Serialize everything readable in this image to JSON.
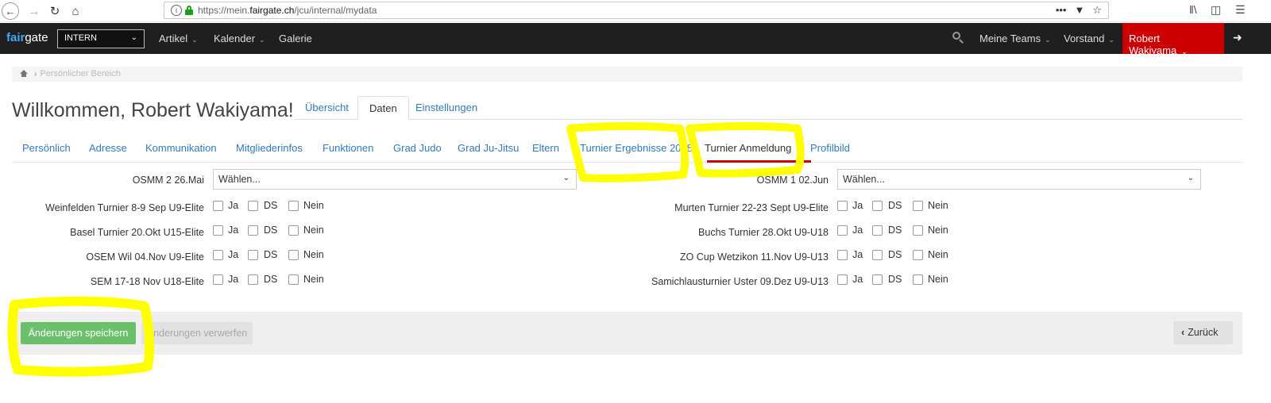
{
  "browser": {
    "url_prefix": "https://mein.",
    "url_domain": "fairgate.ch",
    "url_path": "/jcu/internal/mydata",
    "more_icon": "•••"
  },
  "nav": {
    "logo_a": "fair",
    "logo_b": "gate",
    "org_select": "INTERN",
    "items": [
      "Artikel",
      "Kalender",
      "Galerie"
    ],
    "right_items": [
      "Meine Teams",
      "Vorstand"
    ],
    "user": "Robert Wakiyama"
  },
  "breadcrumb": {
    "label": "Persönlicher Bereich"
  },
  "page": {
    "title": "Willkommen, Robert Wakiyama!"
  },
  "main_tabs": [
    {
      "label": "Übersicht",
      "active": false
    },
    {
      "label": "Daten",
      "active": true
    },
    {
      "label": "Einstellungen",
      "active": false
    }
  ],
  "sub_tabs": [
    {
      "label": "Persönlich"
    },
    {
      "label": "Adresse"
    },
    {
      "label": "Kommunikation"
    },
    {
      "label": "Mitgliederinfos"
    },
    {
      "label": "Funktionen"
    },
    {
      "label": "Grad Judo"
    },
    {
      "label": "Grad Ju-Jitsu"
    },
    {
      "label": "Eltern"
    },
    {
      "label": "Turnier Ergebnisse 2018"
    },
    {
      "label": "Turnier Anmeldung",
      "active": true
    },
    {
      "label": "Profilbild"
    }
  ],
  "form": {
    "select_placeholder": "Wählen...",
    "left": {
      "select_label": "OSMM 2 26.Mai",
      "rows": [
        "Weinfelden Turnier 8-9 Sep U9-Elite",
        "Basel Turnier 20.Okt U15-Elite",
        "OSEM Wil 04.Nov U9-Elite",
        "SEM 17-18 Nov U18-Elite"
      ]
    },
    "right": {
      "select_label": "OSMM 1 02.Jun",
      "rows": [
        "Murten Turnier 22-23 Sept U9-Elite",
        "Buchs Turnier 28.Okt U9-U18",
        "ZO Cup Wetzikon 11.Nov U9-U13",
        "Samichlausturnier Uster 09.Dez U9-U13"
      ]
    },
    "options": [
      "Ja",
      "DS",
      "Nein"
    ]
  },
  "footer": {
    "save": "Änderungen speichern",
    "discard": "Änderungen verwerfen",
    "back": "Zurück"
  },
  "colors": {
    "nav_bg": "#1f1f1f",
    "user_menu_bg": "#cc0000",
    "link": "#337ab7",
    "save_btn": "#6cc06c",
    "highlight": "#ffff00",
    "active_underline": "#cc0000"
  }
}
